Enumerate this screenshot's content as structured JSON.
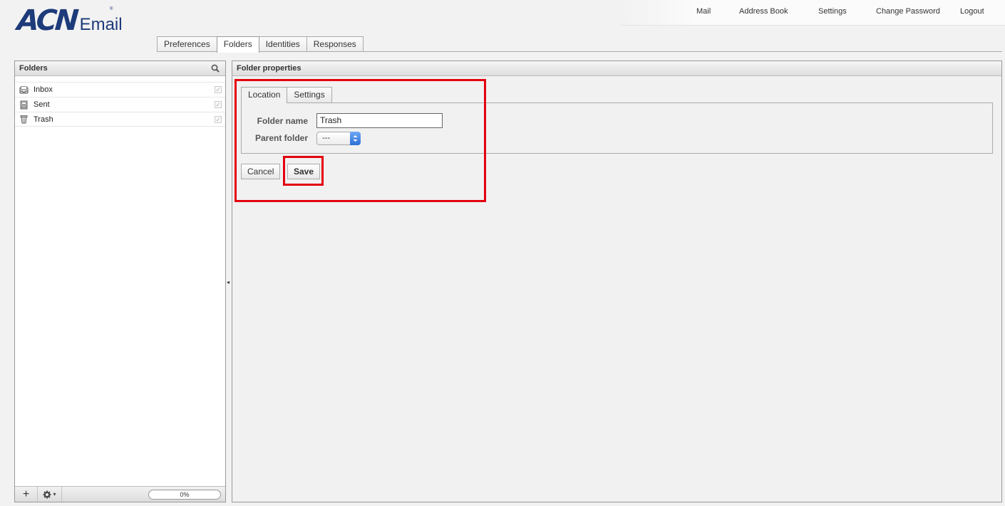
{
  "brand": {
    "name": "ACN",
    "product": "Email",
    "tm": "®",
    "color": "#1d3a7a"
  },
  "topnav": [
    "Mail",
    "Address Book",
    "Settings",
    "Change Password",
    "Logout"
  ],
  "settings_tabs": [
    "Preferences",
    "Folders",
    "Identities",
    "Responses"
  ],
  "settings_active_tab": "Folders",
  "folders_panel": {
    "title": "Folders",
    "items": [
      {
        "name": "Inbox",
        "icon": "inbox-icon",
        "subscribed": true
      },
      {
        "name": "Sent",
        "icon": "sent-icon",
        "subscribed": true
      },
      {
        "name": "Trash",
        "icon": "trash-icon",
        "subscribed": true
      }
    ],
    "footer": {
      "add": "+",
      "options": "▾",
      "quota": "0%"
    }
  },
  "props_panel": {
    "title": "Folder properties",
    "tabs": [
      "Location",
      "Settings"
    ],
    "active_tab": "Location",
    "folder_name_label": "Folder name",
    "folder_name_value": "Trash",
    "parent_folder_label": "Parent folder",
    "parent_folder_value": "---",
    "cancel_label": "Cancel",
    "save_label": "Save"
  },
  "highlight_color": "#e3000f"
}
